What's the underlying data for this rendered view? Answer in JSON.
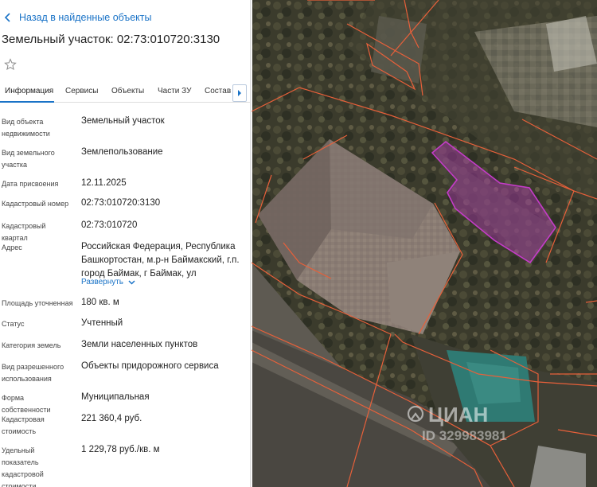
{
  "nav": {
    "back_label": "Назад в найденные объекты"
  },
  "object": {
    "title": "Земельный участок: 02:73:010720:3130"
  },
  "icons": {
    "back": "chevron-left-icon",
    "favorite": "star-outline-icon",
    "tabs_next": "chevron-right-icon",
    "expand": "chevron-down-icon"
  },
  "tabs": [
    {
      "label": "Информация",
      "active": true
    },
    {
      "label": "Сервисы",
      "active": false
    },
    {
      "label": "Объекты",
      "active": false
    },
    {
      "label": "Части ЗУ",
      "active": false
    },
    {
      "label": "Состав",
      "active": false
    }
  ],
  "details": [
    {
      "label": "Вид объекта недвижимости",
      "value": "Земельный участок"
    },
    {
      "label": "Вид земельного участка",
      "value": "Землепользование"
    },
    {
      "label": "Дата присвоения",
      "value": "12.11.2025"
    },
    {
      "label": "Кадастровый номер",
      "value": "02:73:010720:3130"
    },
    {
      "label": "Кадастровый квартал",
      "value": "02:73:010720"
    },
    {
      "label": "Адрес",
      "value": "Российская Федерация, Республика Башкортостан, м.р-н Баймакский, г.п. город Баймак, г Баймак, ул"
    },
    {
      "label": "Площадь уточненная",
      "value": "180 кв. м"
    },
    {
      "label": "Статус",
      "value": "Учтенный"
    },
    {
      "label": "Категория земель",
      "value": "Земли населенных пунктов"
    },
    {
      "label": "Вид разрешенного использования",
      "value": "Объекты придорожного сервиса"
    },
    {
      "label": "Форма собственности",
      "value": "Муниципальная"
    },
    {
      "label": "Кадастровая стоимость",
      "value": "221 360,4 руб."
    },
    {
      "label": "Удельный показатель кадастровой стоимости",
      "value": "1 229,78 руб./кв. м"
    }
  ],
  "address_expand": "Развернуть",
  "map": {
    "watermark_brand": "ЦИАН",
    "watermark_id": "ID 329983981",
    "parcel_color": "#c43cc8",
    "boundary_color": "#e8603a"
  }
}
